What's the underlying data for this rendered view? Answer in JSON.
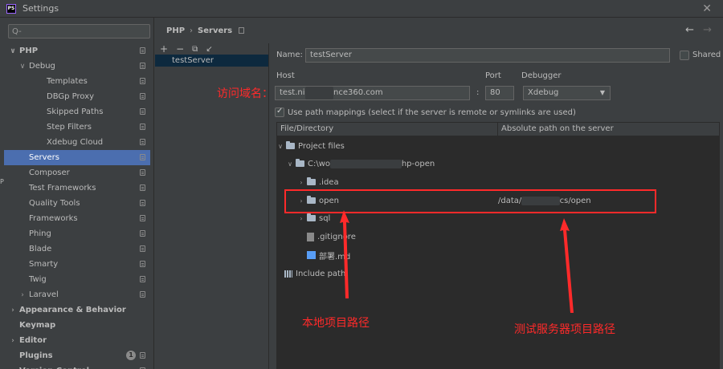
{
  "window": {
    "title": "Settings",
    "app_icon": "PS",
    "close": "✕"
  },
  "search": {
    "placeholder": "",
    "icon": "Q-"
  },
  "tree": [
    {
      "label": "PHP",
      "level": 0,
      "arrow": "∨",
      "bold": true,
      "page": true
    },
    {
      "label": "Debug",
      "level": 1,
      "arrow": "∨",
      "page": true
    },
    {
      "label": "Templates",
      "level": 2,
      "page": true
    },
    {
      "label": "DBGp Proxy",
      "level": 2,
      "page": true
    },
    {
      "label": "Skipped Paths",
      "level": 2,
      "page": true
    },
    {
      "label": "Step Filters",
      "level": 2,
      "page": true
    },
    {
      "label": "Xdebug Cloud",
      "level": 2,
      "page": true
    },
    {
      "label": "Servers",
      "level": 1,
      "selected": true,
      "page": true
    },
    {
      "label": "Composer",
      "level": 1,
      "page": true
    },
    {
      "label": "Test Frameworks",
      "level": 1,
      "page": true
    },
    {
      "label": "Quality Tools",
      "level": 1,
      "page": true
    },
    {
      "label": "Frameworks",
      "level": 1,
      "page": true
    },
    {
      "label": "Phing",
      "level": 1,
      "page": true
    },
    {
      "label": "Blade",
      "level": 1,
      "page": true
    },
    {
      "label": "Smarty",
      "level": 1,
      "page": true
    },
    {
      "label": "Twig",
      "level": 1,
      "page": true
    },
    {
      "label": "Laravel",
      "level": 1,
      "arrow": "›",
      "page": true
    },
    {
      "label": "Appearance & Behavior",
      "level": 0,
      "arrow": "›",
      "bold": true
    },
    {
      "label": "Keymap",
      "level": 0,
      "bold": true
    },
    {
      "label": "Editor",
      "level": 0,
      "arrow": "›",
      "bold": true
    },
    {
      "label": "Plugins",
      "level": 0,
      "bold": true,
      "badge": "1",
      "page": true
    },
    {
      "label": "Version Control",
      "level": 0,
      "arrow": "›",
      "bold": true,
      "page": true
    }
  ],
  "breadcrumb": {
    "part1": "PHP",
    "sep": "›",
    "part2": "Servers"
  },
  "nav": {
    "back": "←",
    "forward": "→"
  },
  "list_toolbar": {
    "add": "+",
    "remove": "−",
    "copy": "⧉",
    "edit": "↙"
  },
  "servers": [
    "testServer"
  ],
  "form": {
    "name_label": "Name:",
    "name_value": "testServer",
    "shared_label": "Shared",
    "host_label": "Host",
    "host_prefix": "test.ni",
    "host_suffix": "nce360.com",
    "port_label": "Port",
    "port_colon": ":",
    "port_value": "80",
    "debugger_label": "Debugger",
    "debugger_value": "Xdebug",
    "path_mappings_label": "Use path mappings (select if the server is remote or symlinks are used)"
  },
  "grid": {
    "col1": "File/Directory",
    "col2": "Absolute path on the server",
    "project_files": "Project files",
    "root_prefix": "C:\\wo",
    "root_suffix": "hp-open",
    "idea": ".idea",
    "open": "open",
    "open_server_prefix": "/data/",
    "open_server_suffix": "cs/open",
    "sql": "sql",
    "gitignore": ".gitignore",
    "deploy_md": "部署.md",
    "include_path": "Include path"
  },
  "annotations": {
    "domain_label": "访问域名：",
    "local_path": "本地项目路径",
    "server_path": "测试服务器项目路径",
    "accent": "#ff2a2a"
  },
  "colors": {
    "selection": "#4b6eaf",
    "background": "#3c3f41",
    "panel": "#2b2b2b"
  }
}
